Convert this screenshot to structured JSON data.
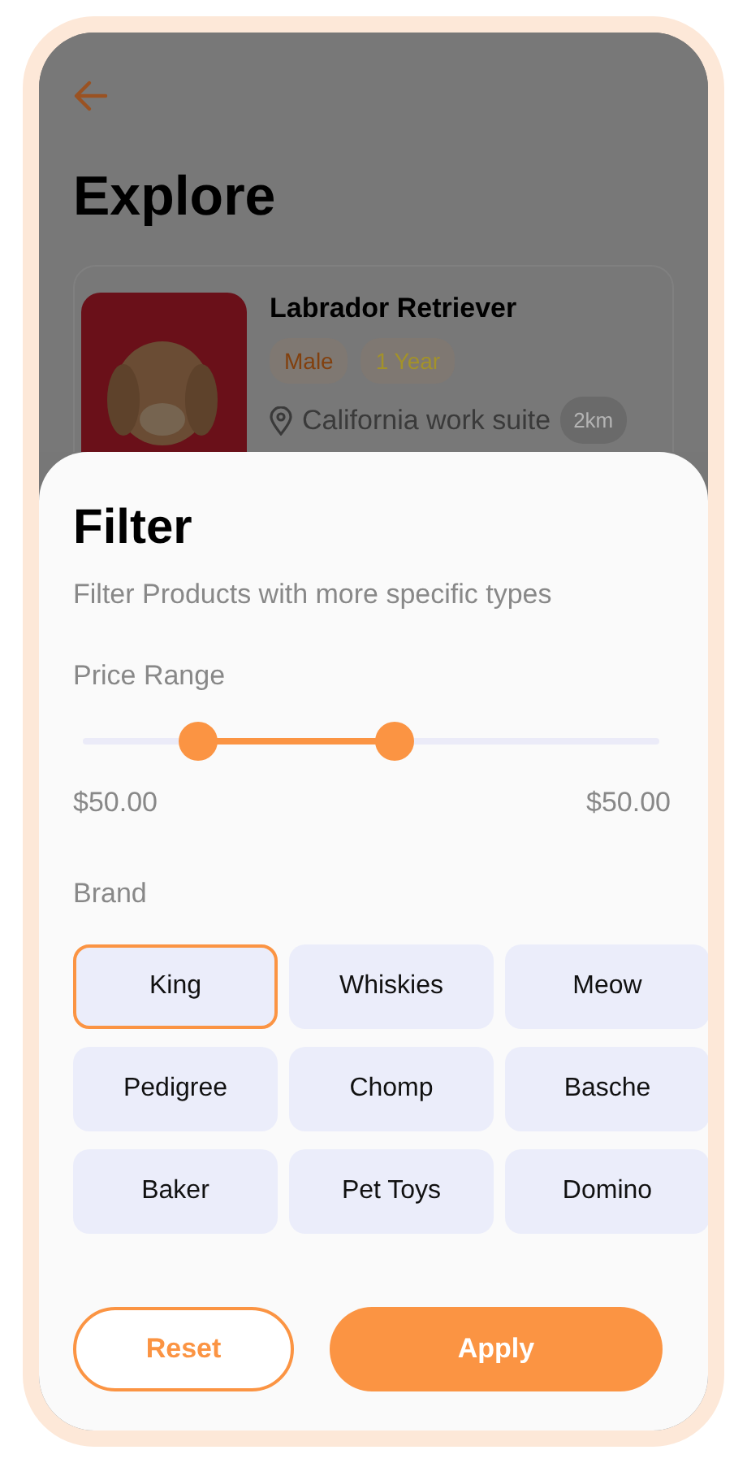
{
  "header": {
    "title": "Explore"
  },
  "pet_card": {
    "name": "Labrador Retriever",
    "tags": [
      {
        "label": "Male",
        "color": "#82400e"
      },
      {
        "label": "1 Year",
        "color": "#a3922a"
      }
    ],
    "location": "California work suite",
    "distance": "2km"
  },
  "filter": {
    "title": "Filter",
    "subtitle": "Filter Products with more specific types",
    "price_label": "Price Range",
    "price_range": {
      "thumbs": [
        {
          "level": 0.2
        },
        {
          "level": 0.54
        }
      ]
    },
    "min_price": "$50.00",
    "max_price": "$50.00",
    "brand_label": "Brand",
    "brands": [
      {
        "label": "King",
        "selected": true
      },
      {
        "label": "Whiskies",
        "selected": false
      },
      {
        "label": "Meow",
        "selected": false
      },
      {
        "label": "Pedigree",
        "selected": false
      },
      {
        "label": "Chomp",
        "selected": false
      },
      {
        "label": "Basche",
        "selected": false
      },
      {
        "label": "Baker",
        "selected": false
      },
      {
        "label": "Pet Toys",
        "selected": false
      },
      {
        "label": "Domino",
        "selected": false
      }
    ],
    "buttons": [
      {
        "label": "Reset",
        "kind": "outline"
      },
      {
        "label": "Apply",
        "kind": "filled"
      }
    ]
  }
}
